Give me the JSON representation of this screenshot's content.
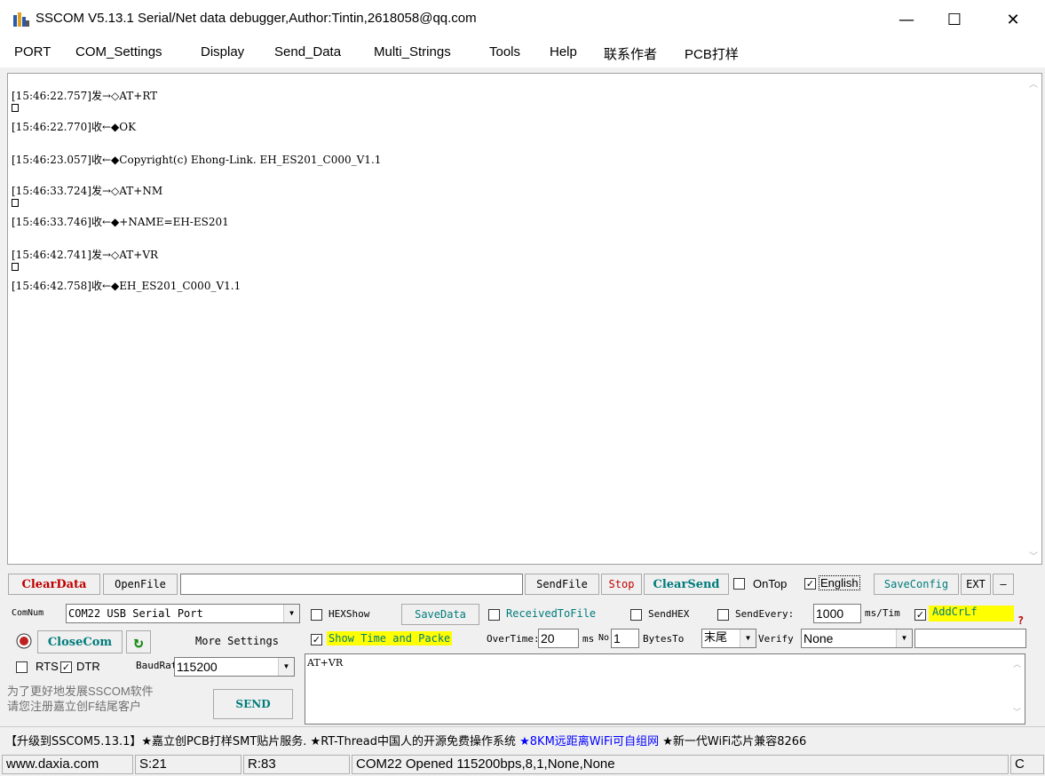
{
  "window": {
    "title": "SSCOM V5.13.1 Serial/Net data debugger,Author:Tintin,2618058@qq.com",
    "minimize": "—",
    "maximize": "☐",
    "close": "✕"
  },
  "menu": [
    "PORT",
    "COM_Settings",
    "Display",
    "Send_Data",
    "Multi_Strings",
    "Tools",
    "Help",
    "联系作者",
    "PCB打样"
  ],
  "receive": {
    "lines": [
      "[15:46:22.757]发→◇AT+RT",
      "[15:46:22.770]收←◆OK",
      "[15:46:23.057]收←◆Copyright(c) Ehong-Link. EH_ES201_C000_V1.1",
      "[15:46:33.724]发→◇AT+NM",
      "[15:46:33.746]收←◆+NAME=EH-ES201",
      "[15:46:42.741]发→◇AT+VR",
      "[15:46:42.758]收←◆EH_ES201_C000_V1.1"
    ]
  },
  "toolbar": {
    "clear_data": "ClearData",
    "open_file": "OpenFile",
    "file_path": "",
    "send_file": "SendFile",
    "stop": "Stop",
    "clear_send": "ClearSend",
    "on_top": "OnTop",
    "english": "English",
    "save_config": "SaveConfig",
    "ext": "EXT",
    "dash": "—"
  },
  "settings": {
    "com_num_label": "ComNum",
    "com_port": "COM22 USB Serial Port",
    "hex_show": "HEXShow",
    "save_data": "SaveData",
    "received_to_file": "ReceivedToFile",
    "send_hex": "SendHEX",
    "send_every": "SendEvery:",
    "send_every_value": "1000",
    "ms_tim": "ms/Tim",
    "add_crlf": "AddCrLf",
    "help_mark": "?",
    "close_com": "CloseCom",
    "more_settings": "More Settings",
    "show_time": "Show Time and Packe",
    "overtime": "OverTime:",
    "overtime_value": "20",
    "ms": "ms",
    "no": "No",
    "no_value": "1",
    "bytes_to": "BytesTo",
    "bytes_to_value": "末尾",
    "verify": "Verify",
    "verify_value": "None",
    "rts": "RTS",
    "dtr": "DTR",
    "baud_label": "BaudRat",
    "baud_value": "115200",
    "send_text": "AT+VR",
    "promo": "为了更好地发展SSCOM软件\n请您注册嘉立创F结尾客户",
    "send_button": "SEND"
  },
  "marquee": {
    "part1": "【升级到SSCOM5.13.1】★嘉立创PCB打样SMT贴片服务. ★RT-Thread中国人的开源免费操作系统 ",
    "part2": "★8KM远距离WiFi可自组网",
    "part3": " ★新一代WiFi芯片兼容8266"
  },
  "status": {
    "site": "www.daxia.com",
    "s": "S:21",
    "r": "R:83",
    "port_info": "COM22 Opened  115200bps,8,1,None,None",
    "extra": "C"
  },
  "colors": {
    "red_text": "#c00000",
    "teal_text": "#007b7b",
    "highlight": "#ffff00",
    "blue_link": "#0000ff"
  }
}
